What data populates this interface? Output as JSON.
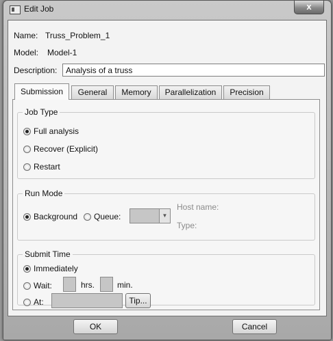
{
  "window": {
    "title": "Edit Job",
    "close_label": "x"
  },
  "job": {
    "name_label": "Name:",
    "name_value": "Truss_Problem_1",
    "model_label": "Model:",
    "model_value": "Model-1",
    "description_label": "Description:",
    "description_value": "Analysis of a truss"
  },
  "tabs": [
    {
      "label": "Submission",
      "active": true
    },
    {
      "label": "General",
      "active": false
    },
    {
      "label": "Memory",
      "active": false
    },
    {
      "label": "Parallelization",
      "active": false
    },
    {
      "label": "Precision",
      "active": false
    }
  ],
  "job_type": {
    "legend": "Job Type",
    "options": [
      "Full analysis",
      "Recover (Explicit)",
      "Restart"
    ],
    "selected": "Full analysis"
  },
  "run_mode": {
    "legend": "Run Mode",
    "background_label": "Background",
    "queue_label": "Queue:",
    "selected": "Background",
    "host_name_label": "Host name:",
    "type_label": "Type:"
  },
  "submit_time": {
    "legend": "Submit Time",
    "immediately_label": "Immediately",
    "wait_label": "Wait:",
    "hrs_label": "hrs.",
    "min_label": "min.",
    "at_label": "At:",
    "tip_label": "Tip...",
    "selected": "Immediately"
  },
  "buttons": {
    "ok": "OK",
    "cancel": "Cancel"
  }
}
